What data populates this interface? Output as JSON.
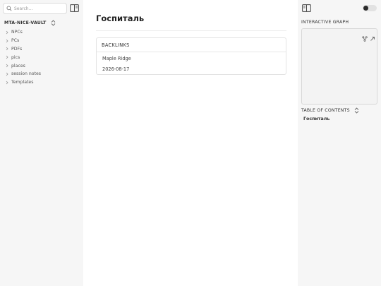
{
  "left_sidebar": {
    "search": {
      "placeholder": "Search..."
    },
    "vault_name": "MTA-NICE-VAULT",
    "tree": [
      {
        "label": "NPCs"
      },
      {
        "label": "PCs"
      },
      {
        "label": "PDFs"
      },
      {
        "label": "pics"
      },
      {
        "label": "places"
      },
      {
        "label": "session notes"
      },
      {
        "label": "Templates"
      }
    ]
  },
  "main": {
    "title": "Госпиталь",
    "backlinks": {
      "header": "BACKLINKS",
      "items": [
        "Maple Ridge",
        "2026-08-17"
      ]
    }
  },
  "right_sidebar": {
    "graph_label": "INTERACTIVE GRAPH",
    "toc_label": "TABLE OF CONTENTS",
    "toc_items": [
      "Госпиталь"
    ]
  },
  "icons": {
    "search": "search-icon",
    "sidebar_toggle": "sidebar-toggle-icon",
    "sort": "sort-icon",
    "chevron": "chevron-right-icon",
    "graph_settings": "graph-settings-icon",
    "expand": "expand-icon"
  },
  "colors": {
    "sidebar_bg": "#f6f6f6",
    "main_bg": "#ffffff",
    "text": "#222222",
    "toggle_knob": "#2b2b2b"
  }
}
